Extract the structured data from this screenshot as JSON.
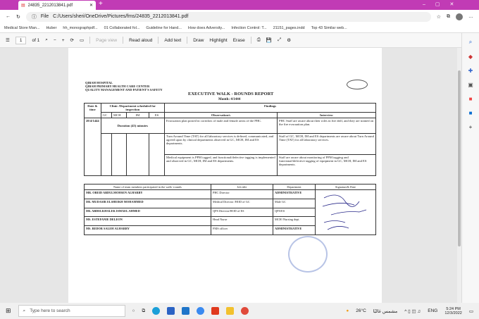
{
  "browser": {
    "tab_title": "24835_2212013841.pdf",
    "address": "C:/Users/sheri/OneDrive/Pictures/fms/24835_2212013841.pdf",
    "file_label": "File",
    "bookmarks": [
      "Medical Store Man...",
      "Huber",
      "hh_monographpdf...",
      "01 Collaborated fol...",
      "Guideline for Hand...",
      "How does Adversity...",
      "Infection Control: T...",
      "21151_pages.indd",
      "Top 43 Similar web..."
    ]
  },
  "pdf_toolbar": {
    "page": "1",
    "of": "of 1",
    "page_view": "Page view",
    "read_aloud": "Read aloud",
    "add_text": "Add text",
    "draw": "Draw",
    "highlight": "Highlight",
    "erase": "Erase"
  },
  "doc": {
    "org": [
      "QIBAH HOSPITAL",
      "QIBAH PRIMARY HEALTH CARE CENTER",
      "QUALITY MANAGEMENT AND PATIENT'S SAFETY"
    ],
    "title": "EXECUTIVE WALK - ROUNDS REPORT",
    "month": "Month: 4/1444",
    "headers": {
      "date": "Date & time",
      "clinic": "Clinic /Department scheduled for inspection",
      "gc": "GC",
      "mch": "MCH",
      "im": "IM",
      "es": "ES",
      "findings": "Findings",
      "observation": "Observation/s",
      "interview": "Interview"
    },
    "date": "28/4/1444",
    "duration": "Duration (45) minutes",
    "findings": [
      {
        "observation": "Evacuation plan posted in corridors of male and female areas of the PHC.",
        "interview": "PHC Staff are aware about their roles in fire drill, and they are trained on the fire evacuation plan."
      },
      {
        "observation": "Turn Around Time (TAT) for all laboratory services is defined, communicated, and agreed upon by clinical departments observed in GC, MCH, IM and ES departments.",
        "interview": "Staff of GC, MCH, IM and ES departments are aware about Turn Around Time (TAT) for all laboratory services."
      },
      {
        "observation": "Medical equipment is PPM tagged, and functional/defective tagging is implemented and observed in GC, MCH, IM and ES departments.",
        "interview": "Staff are aware about monitoring of PPM tagging and functional/defective tagging of equipment in GC, MCH, IM and ES departments."
      }
    ],
    "team_headers": {
      "name": "Name of team members participated in the walk -rounds",
      "job": "Job title",
      "dept": "Department",
      "sig": "Signature& Date"
    },
    "team": [
      {
        "name": "MR. OBEID ABDULMOHSEN ALHARBY",
        "job": "PHC Director",
        "dept": "ADMINISTRATIVE"
      },
      {
        "name": "DR. MUDASIR ELSHEIKH MOHAMMED",
        "job": "Medical Director /HOD of GC",
        "dept": "Male GC"
      },
      {
        "name": "DR. ABDELKHALEK ISMAEL AHMED",
        "job": "QPS Director/HOD of ES",
        "dept": "QPS/ES"
      },
      {
        "name": "MS. ESTEFANIE DELEON",
        "job": "Head Nurse",
        "dept": "MCH /Nursing dept."
      },
      {
        "name": "MS. BEDOR SALEH ALHARBY",
        "job": "FMS officer",
        "dept": "ADMINISTRATIVE"
      }
    ]
  },
  "taskbar": {
    "search_placeholder": "Type here to search",
    "weather": "26°C",
    "weather_desc": "مشمس غالبًا",
    "lang": "ENG",
    "time": "5:24 PM",
    "date": "12/3/2022"
  }
}
